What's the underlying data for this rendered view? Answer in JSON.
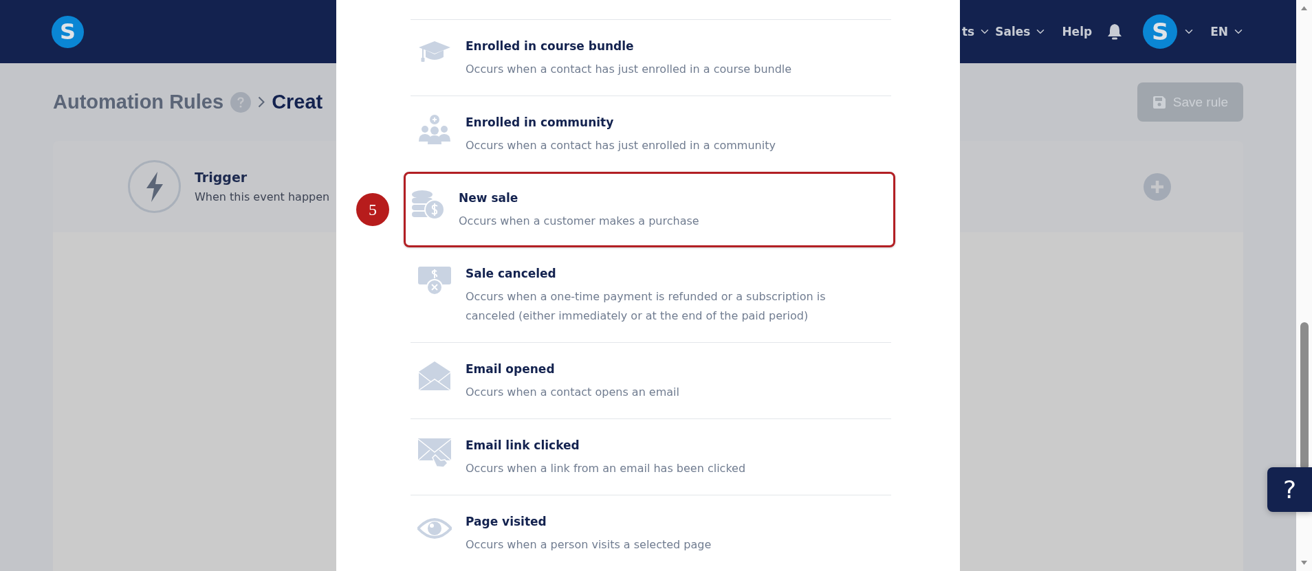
{
  "header": {
    "logo": "S",
    "nav": [
      {
        "label": "ts",
        "dropdown": true
      },
      {
        "label": "Sales",
        "dropdown": true
      },
      {
        "label": "Help",
        "dropdown": false
      }
    ],
    "avatar": "S",
    "language": "EN"
  },
  "breadcrumb": [
    {
      "label": "Automation Rules",
      "help": true
    },
    {
      "label": "Creat",
      "help": false
    }
  ],
  "save_button": {
    "label": "Save rule",
    "disabled": true
  },
  "trigger": {
    "title": "Trigger",
    "subtitle": "When this event happen"
  },
  "modal": {
    "items": [
      {
        "kind": "bundle",
        "title": "Enrolled in course bundle",
        "description": "Occurs when a contact has just enrolled in a course bundle",
        "highlighted": false
      },
      {
        "kind": "community",
        "title": "Enrolled in community",
        "description": "Occurs when a contact has just enrolled in a community",
        "highlighted": false
      },
      {
        "kind": "sale",
        "title": "New sale",
        "description": "Occurs when a customer makes a purchase",
        "highlighted": true,
        "step": "5"
      },
      {
        "kind": "cancel",
        "title": "Sale canceled",
        "description": "Occurs when a one-time payment is refunded or a subscription is canceled (either immediately or at the end of the paid period)",
        "highlighted": false
      },
      {
        "kind": "email",
        "title": "Email opened",
        "description": "Occurs when a contact opens an email",
        "highlighted": false
      },
      {
        "kind": "click",
        "title": "Email link clicked",
        "description": "Occurs when a link from an email has been clicked",
        "highlighted": false
      },
      {
        "kind": "page",
        "title": "Page visited",
        "description": "Occurs when a person visits a selected page",
        "highlighted": false
      }
    ]
  },
  "help_button": {
    "label": "?"
  }
}
